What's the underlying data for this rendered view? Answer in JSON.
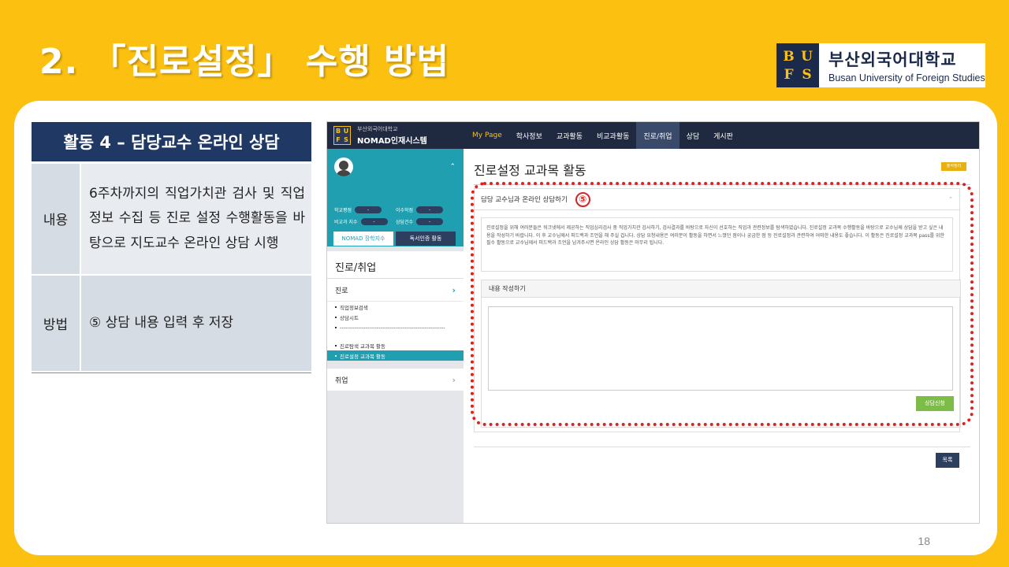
{
  "slide": {
    "title": "2. 「진로설정」 수행 방법",
    "page_number": "18"
  },
  "logo": {
    "mark": [
      "B",
      "U",
      "F",
      "S"
    ],
    "korean": "부산외국어대학교",
    "english": "Busan University of Foreign Studies"
  },
  "info_table": {
    "header": "활동 4 – 담당교수 온라인 상담",
    "rows": [
      {
        "label": "내용",
        "value": "6주차까지의 직업가치관 검사 및 직업정보 수집 등 진로 설정 수행활동을 바탕으로 지도교수 온라인 상담 시행"
      },
      {
        "label": "방법",
        "value": "⑤ 상담 내용 입력 후 저장"
      }
    ]
  },
  "screenshot": {
    "topbar": {
      "logo_mark": [
        "B",
        "U",
        "F",
        "S"
      ],
      "university": "부산외국어대학교",
      "system": "NOMAD인재시스템",
      "nav": [
        "My Page",
        "학사정보",
        "교과활동",
        "비교과활동",
        "진로/취업",
        "상담",
        "게시판"
      ]
    },
    "sidebar": {
      "stats": [
        {
          "label": "학교평점",
          "value": "-"
        },
        {
          "label": "이수학점",
          "value": "-"
        },
        {
          "label": "비교과 지수",
          "value": "-"
        },
        {
          "label": "상담건수",
          "value": "-"
        }
      ],
      "buttons": [
        "NOMAD 장학지수",
        "독서인증 활동"
      ],
      "title": "진로/취업",
      "section_career": "진로",
      "items": [
        "직업정보검색",
        "상담시트",
        "---------------------------------------------------------",
        "진로탐색 교과목 활동",
        "진로설정 교과목 활동"
      ],
      "section_job": "취업"
    },
    "content": {
      "title": "진로설정 교과목 활동",
      "yellow_button": "출석정리",
      "box_title": "담당 교수님과 온라인 상담하기",
      "step_marker": "⑤",
      "description": "진로설정을 위해 여러분들은 워크넷에서 제공하는 직업심리검사 중 직업가치관 검사하기, 검사결과를 바탕으로 자신이 선호하는 직업과 관련정보를 탐색하였습니다. 진로설정 교과목 수행활동을 바탕으로 교수님께 상담을 받고 싶은 내용을 작성하기 바랍니다. 이 후 교수님께서 피드백과 조언을 해 주실 겁니다. 상담 요청내용은 여러분이 활동을 하면서 느꼈던 점이나 궁금한 점 등 진로설정과 관련하여 어떠한 내용도 좋습니다. 이 활동은 진로설정 교과목 pass를 위한 필수 활동으로 교수님께서 피드백과 조언을 남겨주시면 온라인 상담 활동은 마무리 됩니다.",
      "editor_title": "내용 작성하기",
      "submit_button": "상담신청",
      "list_button": "목록"
    }
  },
  "colors": {
    "background": "#fcc010",
    "table_header": "#203864",
    "accent_teal": "#1f9fb0",
    "highlight_red": "#e02020",
    "button_green": "#7cbe45"
  }
}
